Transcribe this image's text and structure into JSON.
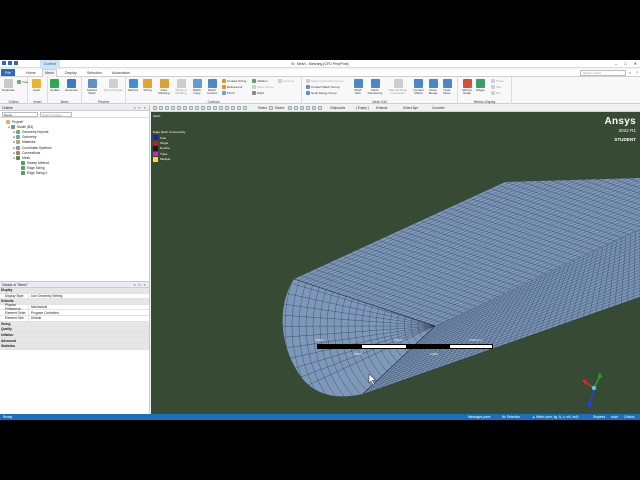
{
  "window": {
    "title": "B : Mesh - Meshing [CFD PrepPost]",
    "context_tab": "Context",
    "controls": [
      "–",
      "□",
      "✕"
    ]
  },
  "tabs": {
    "file": "File",
    "home": "Home",
    "mesh": "Mesh",
    "display": "Display",
    "selection": "Selection",
    "automation": "Automation",
    "search_placeholder": "Quick Launch"
  },
  "ribbon": {
    "outline": {
      "label": "Outline",
      "duplicate": "Duplicate",
      "tree": "Tree"
    },
    "insert": {
      "label": "Insert",
      "insert": "Insert"
    },
    "mesh": {
      "label": "Mesh",
      "update": "Update",
      "generate": "Generate"
    },
    "preview": {
      "label": "Preview",
      "surface_mesh": "Surface Mesh",
      "source_target": "Source/Target"
    },
    "controls": {
      "label": "Controls",
      "method": "Method",
      "sizing": "Sizing",
      "face_meshing": "Face Meshing",
      "mapped_meshing": "Mapped Meshing",
      "match_copy": "Match Copy",
      "match_control": "Match Control",
      "contact_sizing": "Contact Sizing",
      "refinement": "Refinement",
      "pinch": "Pinch",
      "inflation": "Inflation",
      "mesh_group": "Mesh Group",
      "weld": "Weld",
      "connect": "Connect"
    },
    "mesh_edit": {
      "label": "Mesh Edit",
      "mesh_connection_group": "Mesh Connection Group",
      "contact_match_group": "Contact Match Group",
      "node_merge_group": "Node Merge Group",
      "mesh_edit": "Mesh Edit",
      "mesh_numbering": "Mesh Numbering",
      "manual_mesh_connection": "Manual Mesh Connection",
      "contact_match": "Contact Match",
      "node_merge": "Node Merge",
      "node_move": "Node Move"
    },
    "metrics": {
      "label": "Metrics Display",
      "metrics_graph": "Metrics Graph",
      "edges": "Edges",
      "probe": "Probe",
      "max": "Max",
      "min": "Min"
    }
  },
  "toolbar": {
    "select": "Select",
    "mode": "Mode▾",
    "clipboard": "Clipboard▾",
    "empty": "[ Empty ]",
    "extend": "Extend▾",
    "select_by": "Select By▾",
    "convert": "Convert▾"
  },
  "outline": {
    "title": "Outline",
    "filter": "Name",
    "search_placeholder": "Search Outline",
    "tree": [
      {
        "label": "Project*",
        "depth": 0,
        "toggle": "",
        "color": "#d8b35a"
      },
      {
        "label": "Model (B3)",
        "depth": 1,
        "toggle": "⊟",
        "color": "#6c8fd1"
      },
      {
        "label": "Geometry Imports",
        "depth": 2,
        "toggle": "⊞",
        "color": "#7aa67a"
      },
      {
        "label": "Geometry",
        "depth": 2,
        "toggle": "⊞",
        "color": "#6aa0c8"
      },
      {
        "label": "Materials",
        "depth": 2,
        "toggle": "⊞",
        "color": "#c89f55"
      },
      {
        "label": "Coordinate Systems",
        "depth": 2,
        "toggle": "⊞",
        "color": "#8f8fd0"
      },
      {
        "label": "Connections",
        "depth": 2,
        "toggle": "⊞",
        "color": "#b87b5e"
      },
      {
        "label": "Mesh",
        "depth": 2,
        "toggle": "⊟",
        "color": "#4c8f4c"
      },
      {
        "label": "Sweep Method",
        "depth": 3,
        "toggle": "",
        "color": "#5b9b5b"
      },
      {
        "label": "Edge Sizing",
        "depth": 3,
        "toggle": "",
        "color": "#5b9b5b"
      },
      {
        "label": "Edge Sizing 2",
        "depth": 3,
        "toggle": "",
        "color": "#5b9b5b"
      }
    ]
  },
  "details": {
    "title": "Details of \"Mesh\"",
    "rows": [
      {
        "type": "section",
        "key": "Display",
        "value": ""
      },
      {
        "type": "row",
        "key": "Display Style",
        "value": "Use Geometry Setting"
      },
      {
        "type": "section",
        "key": "Defaults",
        "value": ""
      },
      {
        "type": "row",
        "key": "Physics Preference",
        "value": "Mechanical"
      },
      {
        "type": "row",
        "key": "Element Order",
        "value": "Program Controlled"
      },
      {
        "type": "row",
        "key": "Element Size",
        "value": "Default"
      },
      {
        "type": "section",
        "key": "Sizing",
        "value": ""
      },
      {
        "type": "section",
        "key": "Quality",
        "value": ""
      },
      {
        "type": "section",
        "key": "Inflation",
        "value": ""
      },
      {
        "type": "section",
        "key": "Advanced",
        "value": ""
      },
      {
        "type": "section",
        "key": "Statistics",
        "value": ""
      }
    ]
  },
  "viewport": {
    "title": "Mesh",
    "legend_title": "Edge Mesh Connectivity",
    "legend": [
      {
        "label": "Free",
        "color": "#1a1ad9"
      },
      {
        "label": "Single",
        "color": "#d01818"
      },
      {
        "label": "Double",
        "color": "#1c1c1c"
      },
      {
        "label": "Triple",
        "color": "#d01cd0"
      },
      {
        "label": "Multiple",
        "color": "#f0e020"
      }
    ],
    "brand": "Ansys",
    "version": "2022 R1",
    "edition": "STUDENT",
    "scale": {
      "top": [
        "0.000",
        "1.000",
        "2.000 (m)"
      ],
      "bottom": [
        "0.500",
        "1.500"
      ]
    },
    "mesh_color": "#7b96b7",
    "background": "#374a33"
  },
  "status": {
    "ready": "Ready",
    "messages": "Messages pane",
    "selection": "No Selection",
    "units": "▲ Metric (mm, kg, N, s, mV, mA)",
    "angle": "Degrees",
    "rad": "rad/s",
    "temp": "Celsius"
  }
}
